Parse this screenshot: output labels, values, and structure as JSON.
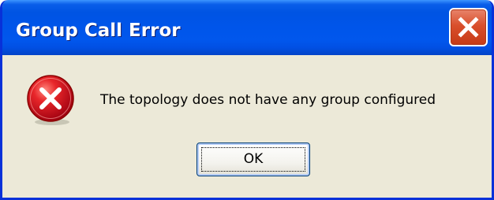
{
  "dialog": {
    "title": "Group Call Error",
    "message": "The topology does not have any group configured",
    "ok_label": "OK",
    "icons": {
      "close": "close-icon",
      "error": "error-icon"
    }
  },
  "colors": {
    "titlebar": "#0054e3",
    "window_border": "#0831d9",
    "dialog_background": "#ece9d8",
    "close_button": "#d94f2c",
    "error_icon": "#d6001c"
  }
}
